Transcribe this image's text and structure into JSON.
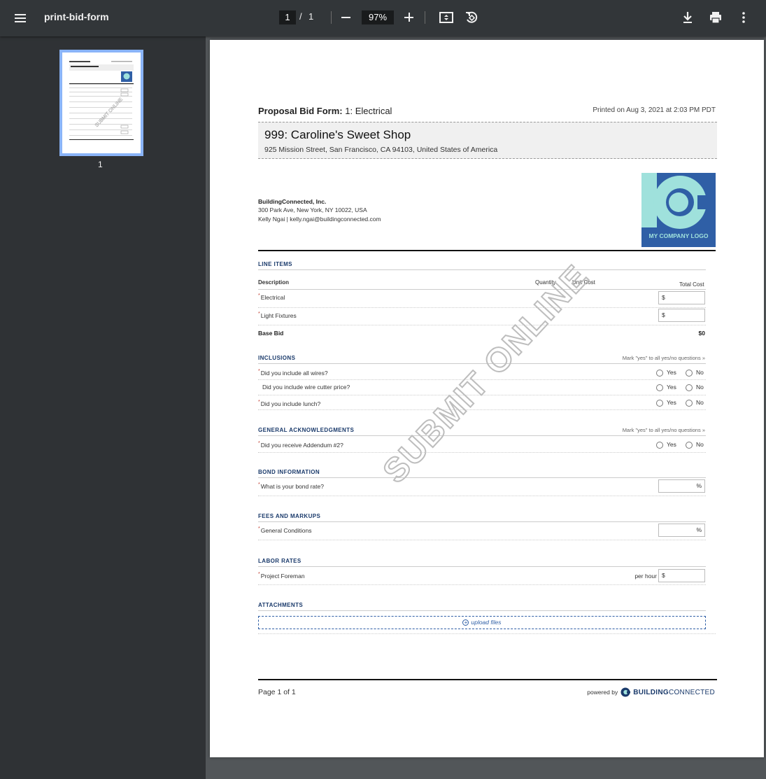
{
  "viewer": {
    "title": "print-bid-form",
    "current_page": "1",
    "page_sep": "/",
    "total_pages": "1",
    "zoom": "97%",
    "thumbnail_label": "1"
  },
  "doc": {
    "form_title_bold": "Proposal Bid Form:",
    "form_title_rest": "1: Electrical",
    "printed": "Printed on Aug 3, 2021 at 2:03 PM PDT",
    "project_name": "999: Caroline's Sweet Shop",
    "project_address": "925 Mission Street, San Francisco, CA 94103, United States of America",
    "company_name": "BuildingConnected, Inc.",
    "company_address": "300 Park Ave, New York, NY 10022, USA",
    "company_contact": "Kelly Ngai | kelly.ngai@buildingconnected.com",
    "logo_text": "MY COMPANY LOGO",
    "watermark": "SUBMIT ONLINE",
    "required_mark": "*",
    "line_items": {
      "heading": "LINE ITEMS",
      "col_description": "Description",
      "col_quantity": "Quantity",
      "col_unit_cost": "Unit Cost",
      "col_total_cost": "Total Cost",
      "rows": [
        {
          "label": "Electrical",
          "prefix": "$"
        },
        {
          "label": "Light Fixtures",
          "prefix": "$"
        }
      ],
      "base_bid_label": "Base Bid",
      "base_bid_value": "$0"
    },
    "inclusions": {
      "heading": "INCLUSIONS",
      "mark_all": "Mark \"yes\" to all yes/no questions »",
      "questions": [
        "Did you include all wires?",
        "Did you include wire cutter price?",
        "Did you include lunch?"
      ]
    },
    "acknowledgments": {
      "heading": "GENERAL ACKNOWLEDGMENTS",
      "mark_all": "Mark \"yes\" to all yes/no questions »",
      "questions": [
        "Did you receive Addendum #2?"
      ]
    },
    "yes": "Yes",
    "no": "No",
    "bond": {
      "heading": "BOND INFORMATION",
      "question": "What is your bond rate?",
      "suffix": "%"
    },
    "fees": {
      "heading": "FEES AND MARKUPS",
      "question": "General Conditions",
      "suffix": "%"
    },
    "labor": {
      "heading": "LABOR RATES",
      "question": "Project Foreman",
      "per_hour": "per hour",
      "prefix": "$"
    },
    "attachments": {
      "heading": "ATTACHMENTS",
      "upload": "upload files"
    },
    "footer": {
      "page": "Page 1 of 1",
      "powered_by": "powered by",
      "brand_bold": "BUILDING",
      "brand_rest": "CONNECTED"
    }
  }
}
